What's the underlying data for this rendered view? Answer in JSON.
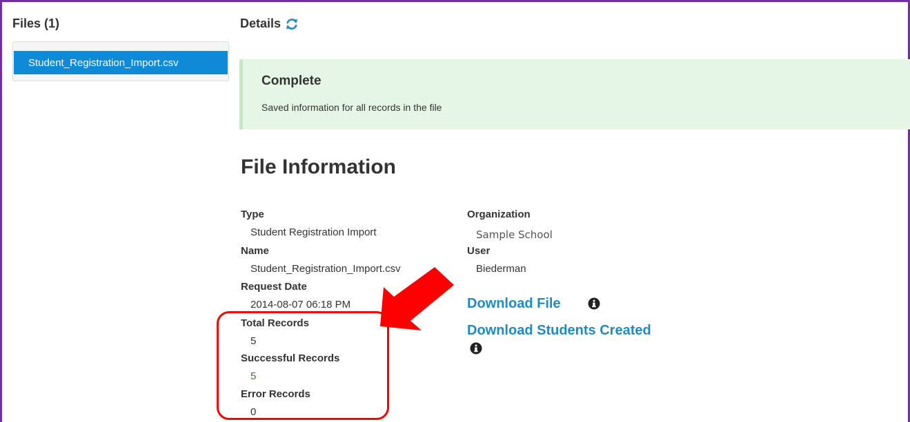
{
  "files": {
    "title": "Files (1)",
    "items": [
      {
        "label": "Student_Registration_Import.csv",
        "selected": true
      }
    ]
  },
  "details": {
    "title": "Details",
    "refresh_icon": "refresh-icon"
  },
  "alert": {
    "title": "Complete",
    "message": "Saved information for all records in the file",
    "color": "#e6f6e6"
  },
  "file_info": {
    "title": "File Information",
    "type_label": "Type",
    "type_value": "Student Registration Import",
    "name_label": "Name",
    "name_value": "Student_Registration_Import.csv",
    "request_date_label": "Request Date",
    "request_date_value": "2014-08-07 06:18 PM",
    "total_label": "Total Records",
    "total_value": "5",
    "successful_label": "Successful Records",
    "successful_value": "5",
    "error_label": "Error Records",
    "error_value": "0",
    "organization_label": "Organization",
    "organization_value": "Sample School",
    "user_label": "User",
    "user_value": "Biederman"
  },
  "links": {
    "download_file": "Download File",
    "download_students": "Download Students Created"
  },
  "colors": {
    "accent": "#0e8ad6",
    "link": "#1a8cc6",
    "frame": "#7030a0",
    "callout": "#ff0000",
    "success": "#3c763d"
  }
}
